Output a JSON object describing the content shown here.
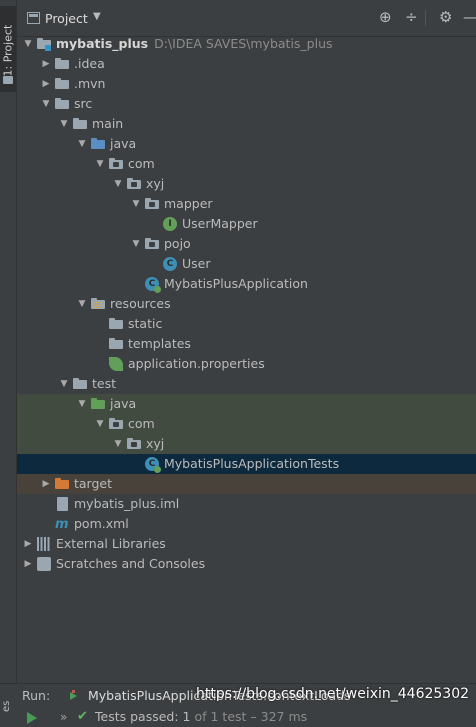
{
  "sidebar": {
    "tab_label": "1: Project",
    "bottom_label": "es"
  },
  "header": {
    "title": "Project",
    "caret": "▼",
    "tools": [
      "⊕",
      "÷",
      "⚙",
      "—"
    ]
  },
  "tree": [
    {
      "label": "mybatis_plus",
      "path": "D:\\IDEA SAVES\\mybatis_plus",
      "depth": 0,
      "arrow": "down",
      "icon": "project-folder"
    },
    {
      "label": ".idea",
      "depth": 1,
      "arrow": "right",
      "icon": "folder"
    },
    {
      "label": ".mvn",
      "depth": 1,
      "arrow": "right",
      "icon": "folder"
    },
    {
      "label": "src",
      "depth": 1,
      "arrow": "down",
      "icon": "folder"
    },
    {
      "label": "main",
      "depth": 2,
      "arrow": "down",
      "icon": "folder"
    },
    {
      "label": "java",
      "depth": 3,
      "arrow": "down",
      "icon": "source-folder"
    },
    {
      "label": "com",
      "depth": 4,
      "arrow": "down",
      "icon": "package"
    },
    {
      "label": "xyj",
      "depth": 5,
      "arrow": "down",
      "icon": "package"
    },
    {
      "label": "mapper",
      "depth": 6,
      "arrow": "down",
      "icon": "package"
    },
    {
      "label": "UserMapper",
      "depth": 7,
      "arrow": "none",
      "icon": "interface"
    },
    {
      "label": "pojo",
      "depth": 6,
      "arrow": "down",
      "icon": "package"
    },
    {
      "label": "User",
      "depth": 7,
      "arrow": "none",
      "icon": "class"
    },
    {
      "label": "MybatisPlusApplication",
      "depth": 6,
      "arrow": "none",
      "icon": "spring-class"
    },
    {
      "label": "resources",
      "depth": 3,
      "arrow": "down",
      "icon": "resources-folder"
    },
    {
      "label": "static",
      "depth": 4,
      "arrow": "none",
      "icon": "folder"
    },
    {
      "label": "templates",
      "depth": 4,
      "arrow": "none",
      "icon": "folder"
    },
    {
      "label": "application.properties",
      "depth": 4,
      "arrow": "none",
      "icon": "properties"
    },
    {
      "label": "test",
      "depth": 2,
      "arrow": "down",
      "icon": "folder"
    },
    {
      "label": "java",
      "depth": 3,
      "arrow": "down",
      "icon": "test-folder",
      "highlight": "green"
    },
    {
      "label": "com",
      "depth": 4,
      "arrow": "down",
      "icon": "package",
      "highlight": "green"
    },
    {
      "label": "xyj",
      "depth": 5,
      "arrow": "down",
      "icon": "package",
      "highlight": "green"
    },
    {
      "label": "MybatisPlusApplicationTests",
      "depth": 6,
      "arrow": "none",
      "icon": "spring-class",
      "highlight": "blue"
    },
    {
      "label": "target",
      "depth": 1,
      "arrow": "right",
      "icon": "excluded-folder",
      "highlight": "brown"
    },
    {
      "label": "mybatis_plus.iml",
      "depth": 1,
      "arrow": "none",
      "icon": "iml-file"
    },
    {
      "label": "pom.xml",
      "depth": 1,
      "arrow": "none",
      "icon": "maven-file"
    },
    {
      "label": "External Libraries",
      "depth": 0,
      "arrow": "right",
      "icon": "libraries"
    },
    {
      "label": "Scratches and Consoles",
      "depth": 0,
      "arrow": "right",
      "icon": "scratches"
    }
  ],
  "run": {
    "label": "Run:",
    "tab_label": "MybatisPlusApplicationTests.contextLoads",
    "close": "×"
  },
  "status": {
    "chevron": "»",
    "check": "✔",
    "passed": "Tests passed: 1",
    "detail": "of 1 test – 327 ms"
  },
  "watermark": "https://blog.csdn.net/weixin_44625302",
  "colors": {
    "background": "#3c3f41",
    "selection_blue": "#0d293e",
    "selection_green": "#414b40",
    "excluded_brown": "#48423a",
    "accent_green": "#499c54"
  }
}
